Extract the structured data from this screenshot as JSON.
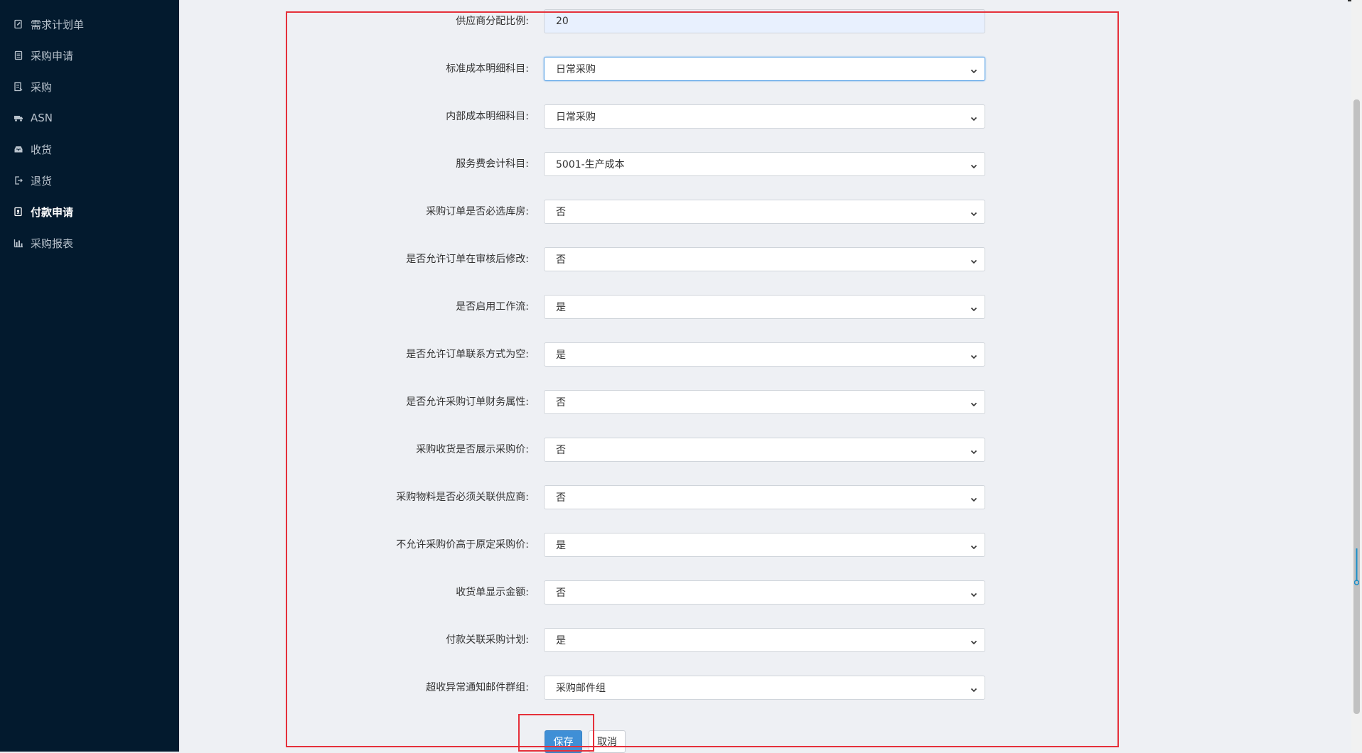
{
  "sidebar": {
    "items": [
      {
        "label": "需求计划单",
        "icon": "document-edit-icon"
      },
      {
        "label": "采购申请",
        "icon": "clipboard-icon"
      },
      {
        "label": "采购",
        "icon": "list-icon"
      },
      {
        "label": "ASN",
        "icon": "truck-icon"
      },
      {
        "label": "收货",
        "icon": "inbox-icon"
      },
      {
        "label": "退货",
        "icon": "logout-icon"
      },
      {
        "label": "付款申请",
        "icon": "payment-doc-icon",
        "active": true
      },
      {
        "label": "采购报表",
        "icon": "bar-chart-icon"
      }
    ]
  },
  "form": {
    "fields": [
      {
        "label": "供应商分配比例:",
        "value": "20",
        "type": "input"
      },
      {
        "label": "标准成本明细科目:",
        "value": "日常采购",
        "type": "select",
        "focused": true
      },
      {
        "label": "内部成本明细科目:",
        "value": "日常采购",
        "type": "select"
      },
      {
        "label": "服务费会计科目:",
        "value": "5001-生产成本",
        "type": "select"
      },
      {
        "label": "采购订单是否必选库房:",
        "value": "否",
        "type": "select"
      },
      {
        "label": "是否允许订单在审核后修改:",
        "value": "否",
        "type": "select"
      },
      {
        "label": "是否启用工作流:",
        "value": "是",
        "type": "select"
      },
      {
        "label": "是否允许订单联系方式为空:",
        "value": "是",
        "type": "select"
      },
      {
        "label": "是否允许采购订单财务属性:",
        "value": "否",
        "type": "select"
      },
      {
        "label": "采购收货是否展示采购价:",
        "value": "否",
        "type": "select"
      },
      {
        "label": "采购物料是否必须关联供应商:",
        "value": "否",
        "type": "select"
      },
      {
        "label": "不允许采购价高于原定采购价:",
        "value": "是",
        "type": "select"
      },
      {
        "label": "收货单显示金额:",
        "value": "否",
        "type": "select"
      },
      {
        "label": "付款关联采购计划:",
        "value": "是",
        "type": "select"
      },
      {
        "label": "超收异常通知邮件群组:",
        "value": "采购邮件组",
        "type": "select"
      }
    ],
    "save_label": "保存",
    "cancel_label": "取消"
  },
  "colors": {
    "sidebar_bg": "#031a2e",
    "highlight_outline": "#e5303a",
    "primary_button": "#3f8fd6"
  }
}
